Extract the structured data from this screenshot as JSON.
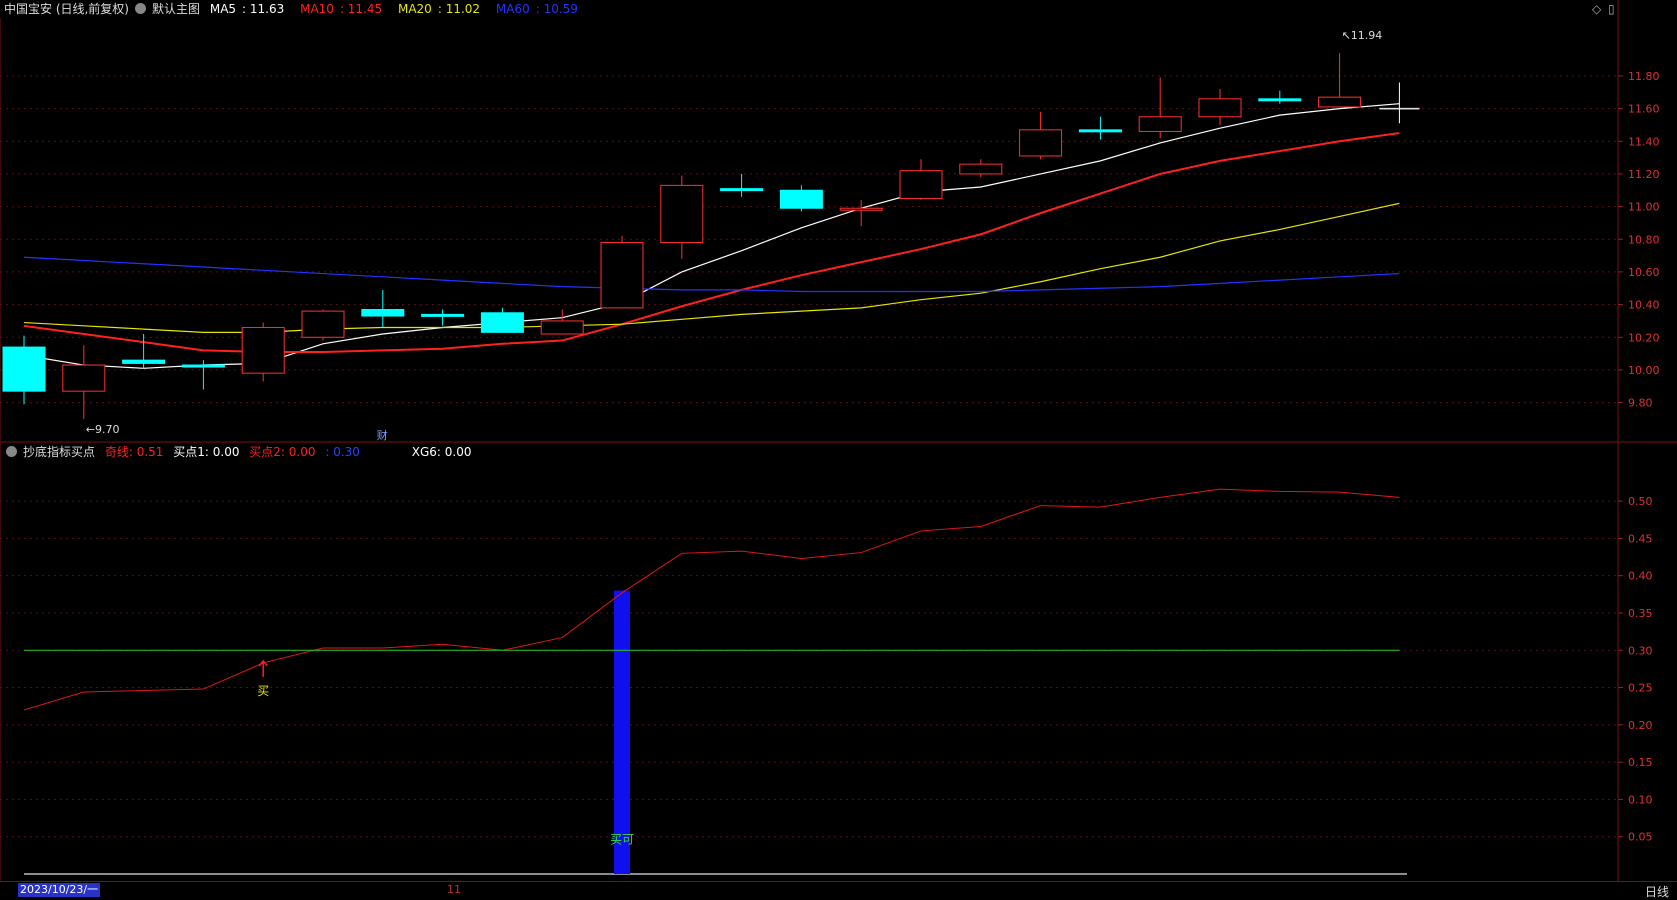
{
  "title": "中国宝安 (日线,前复权)",
  "main_name": "默认主图",
  "ma": [
    {
      "label": "MA5",
      "value": "11.63",
      "color": "#ffffff"
    },
    {
      "label": "MA10",
      "value": "11.45",
      "color": "#ff2020"
    },
    {
      "label": "MA20",
      "value": "11.02",
      "color": "#e6e600"
    },
    {
      "label": "MA60",
      "value": "10.59",
      "color": "#2233ff"
    }
  ],
  "indicator": {
    "name": "抄底指标买点",
    "items": [
      {
        "label": "奇线: 0.51",
        "color": "#ff2020"
      },
      {
        "label": "买点1: 0.00",
        "color": "#ffffff"
      },
      {
        "label": "买点2: 0.00",
        "color": "#ff2020"
      },
      {
        "label": ": 0.30",
        "color": "#2244ff"
      },
      {
        "label": "XG6: 0.00",
        "color": "#ffffff"
      }
    ]
  },
  "status": {
    "date": "2023/10/23/一",
    "tick": "11",
    "period": "日线"
  },
  "chart_data": [
    {
      "type": "candlestick",
      "ylim": [
        9.62,
        12.02
      ],
      "yticks": [
        "11.80",
        "11.60",
        "11.40",
        "11.20",
        "11.00",
        "10.80",
        "10.60",
        "10.40",
        "10.20",
        "10.00",
        "9.80"
      ],
      "candles": [
        {
          "o": 10.14,
          "c": 9.87,
          "h": 10.21,
          "l": 9.79,
          "dir": "down"
        },
        {
          "o": 9.87,
          "c": 10.03,
          "h": 10.15,
          "l": 9.7,
          "dir": "up"
        },
        {
          "o": 10.06,
          "c": 10.04,
          "h": 10.22,
          "l": 10.01,
          "dir": "down"
        },
        {
          "o": 10.03,
          "c": 10.02,
          "h": 10.06,
          "l": 9.88,
          "dir": "down"
        },
        {
          "o": 9.98,
          "c": 10.26,
          "h": 10.29,
          "l": 9.93,
          "dir": "up"
        },
        {
          "o": 10.2,
          "c": 10.36,
          "h": 10.37,
          "l": 10.18,
          "dir": "up"
        },
        {
          "o": 10.37,
          "c": 10.33,
          "h": 10.49,
          "l": 10.26,
          "dir": "down"
        },
        {
          "o": 10.34,
          "c": 10.33,
          "h": 10.37,
          "l": 10.27,
          "dir": "down"
        },
        {
          "o": 10.35,
          "c": 10.23,
          "h": 10.38,
          "l": 10.23,
          "dir": "down"
        },
        {
          "o": 10.22,
          "c": 10.3,
          "h": 10.37,
          "l": 10.22,
          "dir": "up"
        },
        {
          "o": 10.38,
          "c": 10.78,
          "h": 10.82,
          "l": 10.38,
          "dir": "up"
        },
        {
          "o": 10.78,
          "c": 11.13,
          "h": 11.19,
          "l": 10.68,
          "dir": "up"
        },
        {
          "o": 11.11,
          "c": 11.1,
          "h": 11.2,
          "l": 11.06,
          "dir": "down"
        },
        {
          "o": 11.1,
          "c": 10.99,
          "h": 11.13,
          "l": 10.97,
          "dir": "down"
        },
        {
          "o": 10.99,
          "c": 10.99,
          "h": 11.04,
          "l": 10.88,
          "dir": "up"
        },
        {
          "o": 11.05,
          "c": 11.22,
          "h": 11.29,
          "l": 11.04,
          "dir": "up"
        },
        {
          "o": 11.2,
          "c": 11.26,
          "h": 11.29,
          "l": 11.18,
          "dir": "up"
        },
        {
          "o": 11.31,
          "c": 11.47,
          "h": 11.58,
          "l": 11.29,
          "dir": "up"
        },
        {
          "o": 11.47,
          "c": 11.46,
          "h": 11.55,
          "l": 11.41,
          "dir": "down"
        },
        {
          "o": 11.46,
          "c": 11.55,
          "h": 11.79,
          "l": 11.42,
          "dir": "up"
        },
        {
          "o": 11.55,
          "c": 11.66,
          "h": 11.72,
          "l": 11.5,
          "dir": "up"
        },
        {
          "o": 11.66,
          "c": 11.65,
          "h": 11.71,
          "l": 11.63,
          "dir": "down"
        },
        {
          "o": 11.61,
          "c": 11.67,
          "h": 11.94,
          "l": 11.61,
          "dir": "up"
        },
        {
          "o": 11.6,
          "c": 11.6,
          "h": 11.76,
          "l": 11.51,
          "dir": "flat"
        }
      ],
      "series": [
        {
          "name": "MA5",
          "color": "#ffffff",
          "values": [
            10.09,
            10.03,
            10.01,
            10.03,
            10.04,
            10.16,
            10.22,
            10.26,
            10.29,
            10.32,
            10.41,
            10.6,
            10.73,
            10.87,
            10.99,
            11.09,
            11.12,
            11.2,
            11.28,
            11.39,
            11.48,
            11.56,
            11.6,
            11.63
          ]
        },
        {
          "name": "MA10",
          "color": "#ff2020",
          "values": [
            10.27,
            10.22,
            10.17,
            10.12,
            10.11,
            10.11,
            10.12,
            10.13,
            10.16,
            10.18,
            10.28,
            10.39,
            10.49,
            10.58,
            10.66,
            10.74,
            10.83,
            10.96,
            11.08,
            11.2,
            11.28,
            11.34,
            11.4,
            11.45
          ]
        },
        {
          "name": "MA20",
          "color": "#e6e600",
          "values": [
            10.29,
            10.27,
            10.25,
            10.23,
            10.23,
            10.25,
            10.26,
            10.26,
            10.26,
            10.27,
            10.28,
            10.31,
            10.34,
            10.36,
            10.38,
            10.43,
            10.47,
            10.54,
            10.62,
            10.69,
            10.79,
            10.86,
            10.94,
            11.02
          ]
        },
        {
          "name": "MA60",
          "color": "#2233ff",
          "values": [
            10.69,
            10.67,
            10.65,
            10.63,
            10.61,
            10.59,
            10.57,
            10.55,
            10.53,
            10.51,
            10.5,
            10.49,
            10.49,
            10.48,
            10.48,
            10.48,
            10.48,
            10.49,
            10.5,
            10.51,
            10.53,
            10.55,
            10.57,
            10.59
          ]
        }
      ],
      "annotations": [
        {
          "text": "←9.70",
          "candle": 1,
          "value": 9.7
        },
        {
          "text": "↖11.94",
          "candle": 22,
          "value": 11.94
        },
        {
          "text": "财",
          "candle": 6
        }
      ]
    },
    {
      "type": "line",
      "ylim": [
        0,
        0.535
      ],
      "yticks": [
        "0.50",
        "0.45",
        "0.40",
        "0.35",
        "0.30",
        "0.25",
        "0.20",
        "0.15",
        "0.10",
        "0.05"
      ],
      "series": [
        {
          "color": "#e01818",
          "values": [
            0.22,
            0.244,
            0.246,
            0.248,
            0.283,
            0.303,
            0.303,
            0.308,
            0.3,
            0.317,
            0.377,
            0.43,
            0.433,
            0.423,
            0.431,
            0.46,
            0.466,
            0.494,
            0.492,
            0.505,
            0.516,
            0.513,
            0.512,
            0.505
          ]
        },
        {
          "color": "#22cc22",
          "values": [
            0.3,
            0.3,
            0.3,
            0.3,
            0.3,
            0.3,
            0.3,
            0.3,
            0.3,
            0.3,
            0.3,
            0.3,
            0.3,
            0.3,
            0.3,
            0.3,
            0.3,
            0.3,
            0.3,
            0.3,
            0.3,
            0.3,
            0.3,
            0.3
          ]
        }
      ],
      "bars": [
        {
          "candle": 10,
          "value": 0.38,
          "color": "#1010ee",
          "label": "买可",
          "label_color": "#33dd33"
        }
      ],
      "signals": [
        {
          "candle": 4,
          "value": 0.283,
          "text": "买",
          "arrow_color": "#ff2020",
          "text_color": "#e6e600"
        }
      ]
    }
  ]
}
